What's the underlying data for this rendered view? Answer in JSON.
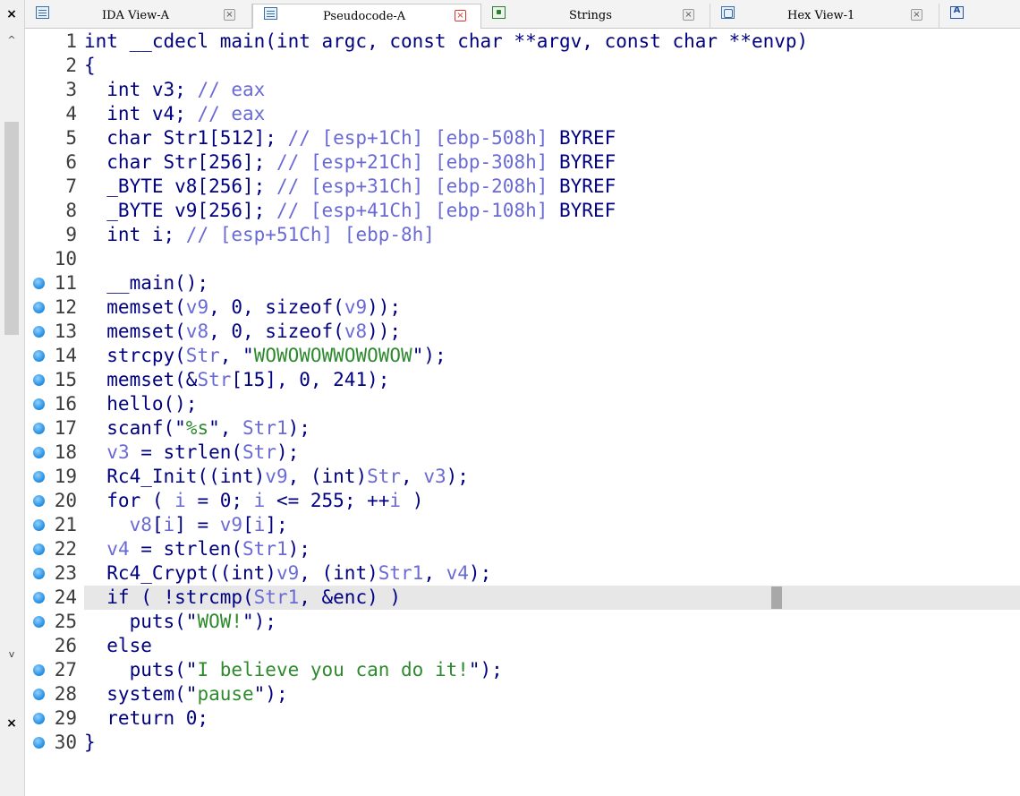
{
  "tabs": [
    {
      "label": "IDA View-A",
      "icon": "listing-icon",
      "active": false
    },
    {
      "label": "Pseudocode-A",
      "icon": "listing-icon",
      "active": true
    },
    {
      "label": "Strings",
      "icon": "strings-icon",
      "active": false
    },
    {
      "label": "Hex View-1",
      "icon": "hex-icon",
      "active": false
    },
    {
      "label": "",
      "icon": "structures-icon",
      "active": false
    }
  ],
  "left_panel": {
    "close_glyph": "×",
    "scroll_up": "^",
    "scroll_down": "v"
  },
  "tab_close_glyph": "×",
  "structures_glyph": "A",
  "code": [
    {
      "n": "1",
      "bp": false,
      "tokens": [
        [
          "t",
          "int __cdecl main(int argc, const char **argv, const char **envp)"
        ]
      ]
    },
    {
      "n": "2",
      "bp": false,
      "tokens": [
        [
          "t",
          "{"
        ]
      ]
    },
    {
      "n": "3",
      "bp": false,
      "tokens": [
        [
          "t",
          "  int v3; "
        ],
        [
          "c",
          "// eax"
        ]
      ]
    },
    {
      "n": "4",
      "bp": false,
      "tokens": [
        [
          "t",
          "  int v4; "
        ],
        [
          "c",
          "// eax"
        ]
      ]
    },
    {
      "n": "5",
      "bp": false,
      "tokens": [
        [
          "t",
          "  char Str1[512]; "
        ],
        [
          "c",
          "// [esp+1Ch] [ebp-508h] "
        ],
        [
          "t",
          "BYREF"
        ]
      ]
    },
    {
      "n": "6",
      "bp": false,
      "tokens": [
        [
          "t",
          "  char Str[256]; "
        ],
        [
          "c",
          "// [esp+21Ch] [ebp-308h] "
        ],
        [
          "t",
          "BYREF"
        ]
      ]
    },
    {
      "n": "7",
      "bp": false,
      "tokens": [
        [
          "t",
          "  _BYTE v8[256]; "
        ],
        [
          "c",
          "// [esp+31Ch] [ebp-208h] "
        ],
        [
          "t",
          "BYREF"
        ]
      ]
    },
    {
      "n": "8",
      "bp": false,
      "tokens": [
        [
          "t",
          "  _BYTE v9[256]; "
        ],
        [
          "c",
          "// [esp+41Ch] [ebp-108h] "
        ],
        [
          "t",
          "BYREF"
        ]
      ]
    },
    {
      "n": "9",
      "bp": false,
      "tokens": [
        [
          "t",
          "  int i; "
        ],
        [
          "c",
          "// [esp+51Ch] [ebp-8h]"
        ]
      ]
    },
    {
      "n": "10",
      "bp": false,
      "tokens": [
        [
          "t",
          ""
        ]
      ]
    },
    {
      "n": "11",
      "bp": true,
      "tokens": [
        [
          "t",
          "  __main();"
        ]
      ]
    },
    {
      "n": "12",
      "bp": true,
      "tokens": [
        [
          "t",
          "  memset("
        ],
        [
          "v",
          "v9"
        ],
        [
          "t",
          ", 0, sizeof("
        ],
        [
          "v",
          "v9"
        ],
        [
          "t",
          "));"
        ]
      ]
    },
    {
      "n": "13",
      "bp": true,
      "tokens": [
        [
          "t",
          "  memset("
        ],
        [
          "v",
          "v8"
        ],
        [
          "t",
          ", 0, sizeof("
        ],
        [
          "v",
          "v8"
        ],
        [
          "t",
          "));"
        ]
      ]
    },
    {
      "n": "14",
      "bp": true,
      "tokens": [
        [
          "t",
          "  strcpy("
        ],
        [
          "v",
          "Str"
        ],
        [
          "t",
          ", \""
        ],
        [
          "s",
          "WOWOWOWWOWOWOW"
        ],
        [
          "t",
          "\");"
        ]
      ]
    },
    {
      "n": "15",
      "bp": true,
      "tokens": [
        [
          "t",
          "  memset(&"
        ],
        [
          "v",
          "Str"
        ],
        [
          "t",
          "[15], 0, 241);"
        ]
      ]
    },
    {
      "n": "16",
      "bp": true,
      "tokens": [
        [
          "t",
          "  hello();"
        ]
      ]
    },
    {
      "n": "17",
      "bp": true,
      "tokens": [
        [
          "t",
          "  scanf(\""
        ],
        [
          "s",
          "%s"
        ],
        [
          "t",
          "\", "
        ],
        [
          "v",
          "Str1"
        ],
        [
          "t",
          ");"
        ]
      ]
    },
    {
      "n": "18",
      "bp": true,
      "tokens": [
        [
          "t",
          "  "
        ],
        [
          "v",
          "v3"
        ],
        [
          "t",
          " = strlen("
        ],
        [
          "v",
          "Str"
        ],
        [
          "t",
          ");"
        ]
      ]
    },
    {
      "n": "19",
      "bp": true,
      "tokens": [
        [
          "t",
          "  Rc4_Init((int)"
        ],
        [
          "v",
          "v9"
        ],
        [
          "t",
          ", (int)"
        ],
        [
          "v",
          "Str"
        ],
        [
          "t",
          ", "
        ],
        [
          "v",
          "v3"
        ],
        [
          "t",
          ");"
        ]
      ]
    },
    {
      "n": "20",
      "bp": true,
      "tokens": [
        [
          "t",
          "  for ( "
        ],
        [
          "v",
          "i"
        ],
        [
          "t",
          " = 0; "
        ],
        [
          "v",
          "i"
        ],
        [
          "t",
          " <= 255; ++"
        ],
        [
          "v",
          "i"
        ],
        [
          "t",
          " )"
        ]
      ]
    },
    {
      "n": "21",
      "bp": true,
      "tokens": [
        [
          "t",
          "    "
        ],
        [
          "v",
          "v8"
        ],
        [
          "t",
          "["
        ],
        [
          "v",
          "i"
        ],
        [
          "t",
          "] = "
        ],
        [
          "v",
          "v9"
        ],
        [
          "t",
          "["
        ],
        [
          "v",
          "i"
        ],
        [
          "t",
          "];"
        ]
      ]
    },
    {
      "n": "22",
      "bp": true,
      "tokens": [
        [
          "t",
          "  "
        ],
        [
          "v",
          "v4"
        ],
        [
          "t",
          " = strlen("
        ],
        [
          "v",
          "Str1"
        ],
        [
          "t",
          ");"
        ]
      ]
    },
    {
      "n": "23",
      "bp": true,
      "tokens": [
        [
          "t",
          "  Rc4_Crypt((int)"
        ],
        [
          "v",
          "v9"
        ],
        [
          "t",
          ", (int)"
        ],
        [
          "v",
          "Str1"
        ],
        [
          "t",
          ", "
        ],
        [
          "v",
          "v4"
        ],
        [
          "t",
          ");"
        ]
      ]
    },
    {
      "n": "24",
      "bp": true,
      "hl": true,
      "tokens": [
        [
          "t",
          "  if ( !strcmp("
        ],
        [
          "v",
          "Str1"
        ],
        [
          "t",
          ", &enc) )"
        ]
      ]
    },
    {
      "n": "25",
      "bp": true,
      "tokens": [
        [
          "t",
          "    puts(\""
        ],
        [
          "s",
          "WOW!"
        ],
        [
          "t",
          "\");"
        ]
      ]
    },
    {
      "n": "26",
      "bp": false,
      "tokens": [
        [
          "t",
          "  else"
        ]
      ]
    },
    {
      "n": "27",
      "bp": true,
      "tokens": [
        [
          "t",
          "    puts(\""
        ],
        [
          "s",
          "I believe you can do it!"
        ],
        [
          "t",
          "\");"
        ]
      ]
    },
    {
      "n": "28",
      "bp": true,
      "tokens": [
        [
          "t",
          "  system(\""
        ],
        [
          "s",
          "pause"
        ],
        [
          "t",
          "\");"
        ]
      ]
    },
    {
      "n": "29",
      "bp": true,
      "tokens": [
        [
          "t",
          "  return 0;"
        ]
      ]
    },
    {
      "n": "30",
      "bp": true,
      "tokens": [
        [
          "t",
          "}"
        ]
      ]
    }
  ],
  "colors": {
    "keyword": "#000080",
    "variable": "#6a6ad6",
    "comment": "#6a6ad6",
    "string": "#2d8a2d",
    "highlight": "#e7e7e7",
    "breakpoint": "#1f8be0"
  }
}
